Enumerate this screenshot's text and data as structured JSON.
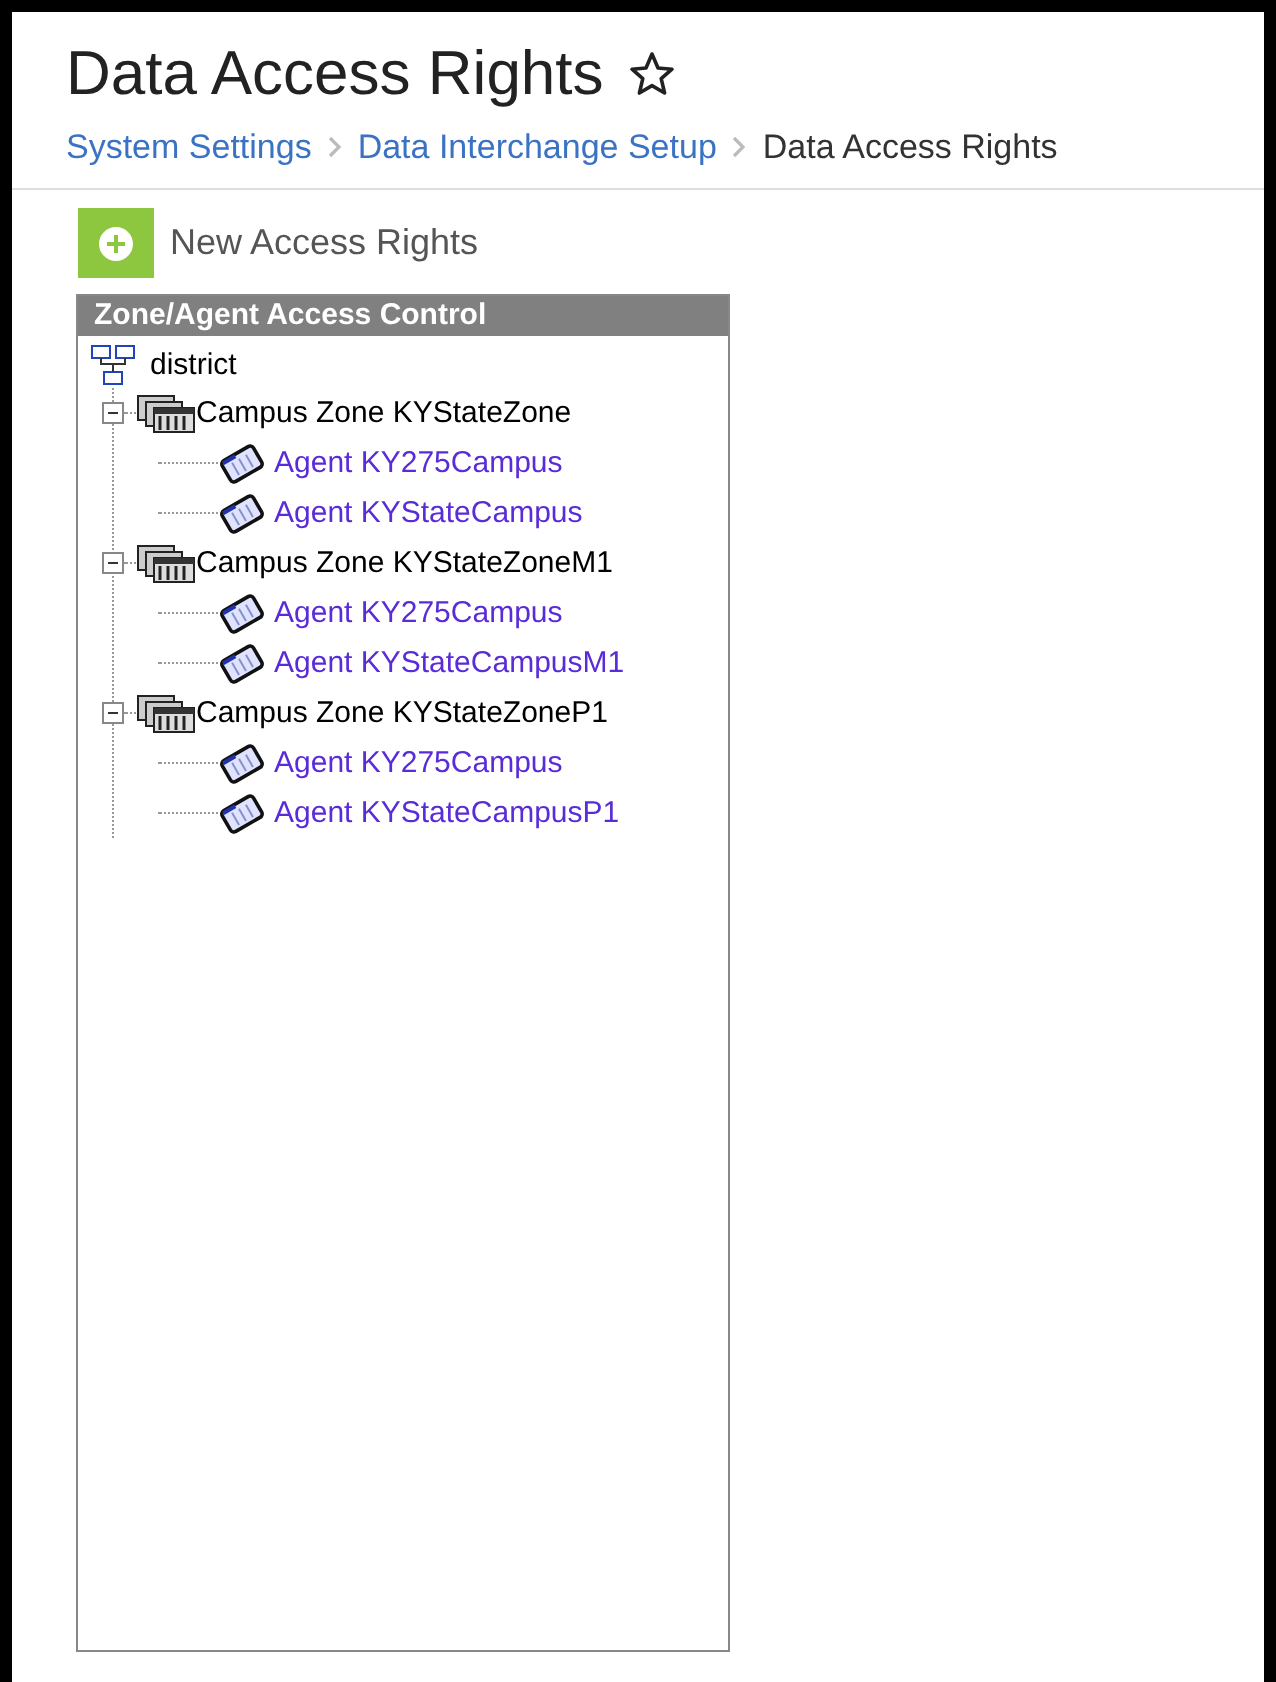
{
  "page": {
    "title": "Data Access Rights",
    "favorite": false
  },
  "breadcrumb": [
    {
      "label": "System Settings",
      "link": true
    },
    {
      "label": "Data Interchange Setup",
      "link": true
    },
    {
      "label": "Data Access Rights",
      "link": false
    }
  ],
  "new_button": {
    "label": "New Access Rights"
  },
  "tree_panel": {
    "header": "Zone/Agent Access Control",
    "root": {
      "label": "district",
      "children": [
        {
          "label": "Campus Zone KYStateZone",
          "expanded": true,
          "children": [
            {
              "label": "Agent KY275Campus"
            },
            {
              "label": "Agent KYStateCampus"
            }
          ]
        },
        {
          "label": "Campus Zone KYStateZoneM1",
          "expanded": true,
          "children": [
            {
              "label": "Agent KY275Campus"
            },
            {
              "label": "Agent KYStateCampusM1"
            }
          ]
        },
        {
          "label": "Campus Zone KYStateZoneP1",
          "expanded": true,
          "children": [
            {
              "label": "Agent KY275Campus"
            },
            {
              "label": "Agent KYStateCampusP1"
            }
          ]
        }
      ]
    }
  }
}
